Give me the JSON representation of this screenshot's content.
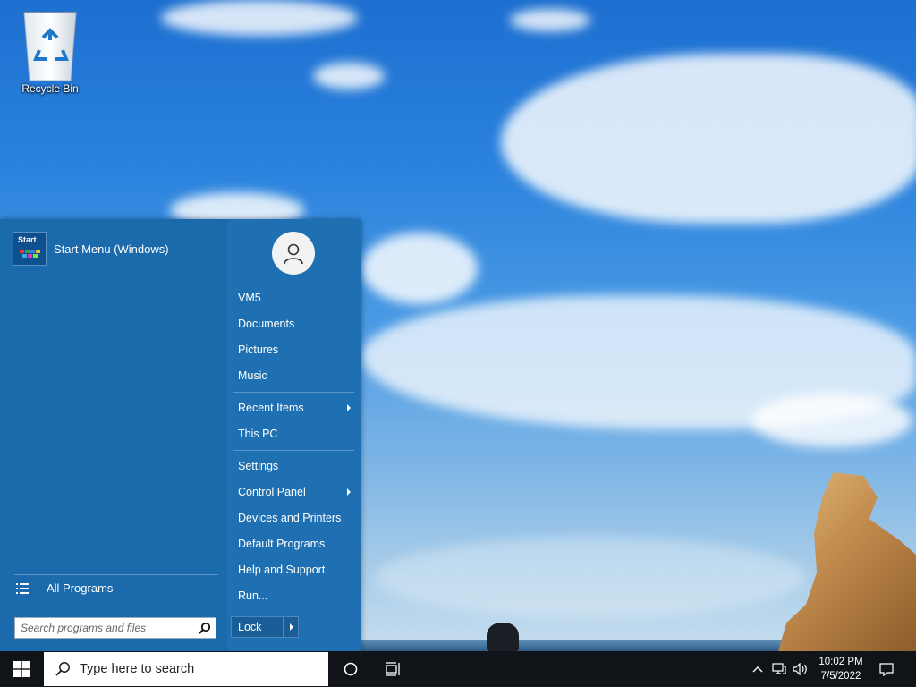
{
  "desktop": {
    "icons": [
      {
        "label": "Recycle Bin",
        "icon": "recycle-bin-icon"
      }
    ]
  },
  "start_menu": {
    "pinned": {
      "label": "Start Menu (Windows)",
      "icon_text": "Start"
    },
    "all_programs": "All Programs",
    "search_placeholder": "Search programs and files",
    "right": {
      "user": "VM5",
      "items": [
        {
          "label": "Documents"
        },
        {
          "label": "Pictures"
        },
        {
          "label": "Music"
        },
        {
          "label": "Recent Items",
          "submenu": true
        },
        {
          "label": "This PC"
        },
        {
          "label": "Settings"
        },
        {
          "label": "Control Panel",
          "submenu": true
        },
        {
          "label": "Devices and Printers"
        },
        {
          "label": "Default Programs"
        },
        {
          "label": "Help and Support"
        },
        {
          "label": "Run..."
        }
      ],
      "lock_label": "Lock"
    }
  },
  "taskbar": {
    "search_placeholder": "Type here to search",
    "time": "10:02 PM",
    "date": "7/5/2022"
  },
  "colors": {
    "start_menu": "#1e6fb0",
    "taskbar": "#101418"
  }
}
